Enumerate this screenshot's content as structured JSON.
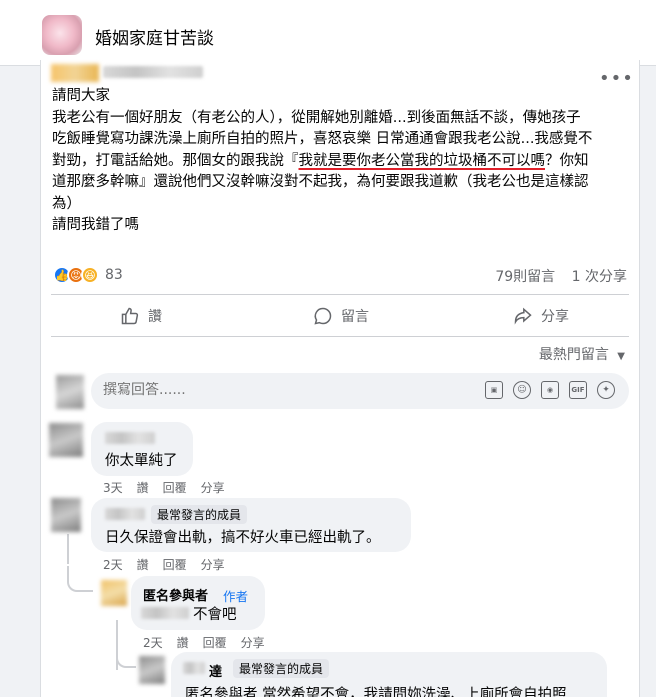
{
  "group": {
    "name": "婚姻家庭甘苦談"
  },
  "post": {
    "lines": [
      "請問大家",
      "我老公有一個好朋友（有老公的人），從開解她別離婚...到後面無話不談，傳她孩子",
      "吃飯睡覺寫功課洗澡上廁所自拍的照片，喜怒哀樂 日常通通會跟我老公說...我感覺不",
      "道那麼多幹嘛』還說他們又沒幹嘛沒對不起我，為何要跟我道歉（我老公也是這樣認",
      "為）",
      "請問我錯了嗎"
    ],
    "line4_pre": "對勁，打電話給她。那個女的跟我說『",
    "line4_underlined": "我就是要你老公當我的垃圾桶不可以嗎",
    "line4_post": "？你知",
    "reaction_count": "83",
    "comment_count": "79則留言",
    "share_count": "1 次分享"
  },
  "actions": {
    "like": "讚",
    "comment": "留言",
    "share": "分享"
  },
  "sort": {
    "label": "最熱門留言"
  },
  "composer": {
    "placeholder": "撰寫回答......"
  },
  "comments": [
    {
      "text": "你太單純了",
      "time": "3天",
      "like": "讚",
      "reply": "回覆",
      "share": "分享"
    },
    {
      "badge": "最常發言的成員",
      "text": "日久保證會出軌，搞不好火車已經出軌了。",
      "time": "2天",
      "like": "讚",
      "reply": "回覆",
      "share": "分享"
    },
    {
      "name": "匿名參與者",
      "author_tag": "作者",
      "text": "不會吧",
      "time": "2天",
      "like": "讚",
      "reply": "回覆",
      "share": "分享"
    },
    {
      "name_suffix": "達",
      "badge": "最常發言的成員",
      "text": "匿名參與者 當然希望不會，我請問妳洗澡、上廁所會自拍照"
    }
  ],
  "colors": {
    "accent": "#1877f2",
    "underline": "#e0202a",
    "muted": "#65676b"
  },
  "icons": [
    "more-icon",
    "like-icon",
    "comment-icon",
    "share-icon",
    "chevron-down-icon",
    "emoji-icon",
    "camera-icon",
    "gif-icon",
    "sticker-icon"
  ]
}
